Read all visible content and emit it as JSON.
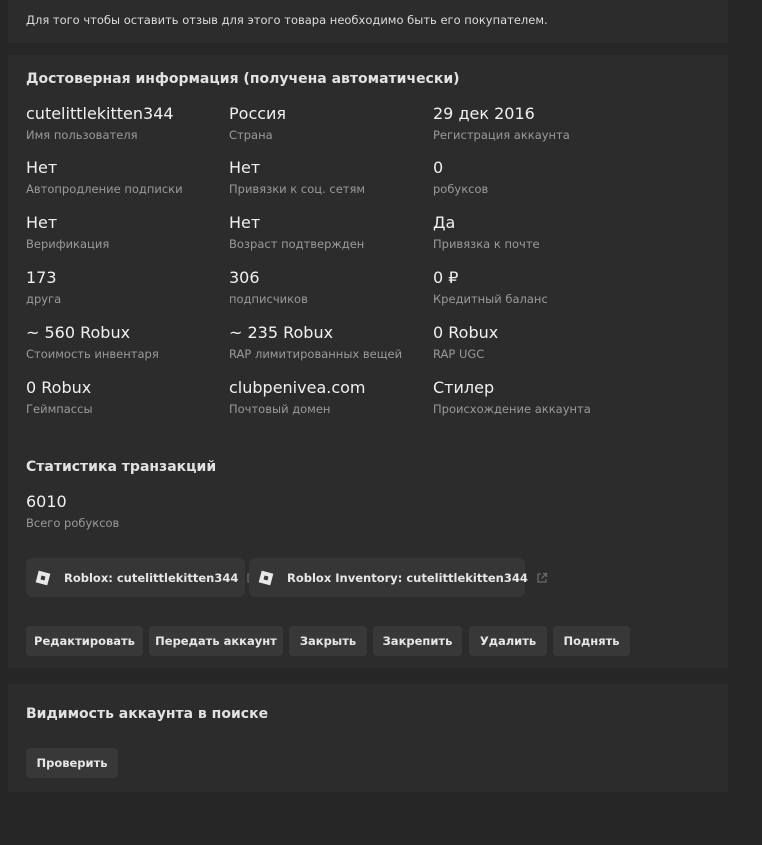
{
  "notice": {
    "text": "Для того чтобы оставить отзыв для этого товара необходимо быть его покупателем."
  },
  "info": {
    "title": "Достоверная информация (получена автоматически)",
    "grid": [
      [
        {
          "value": "cutelittlekitten344",
          "label": "Имя пользователя"
        },
        {
          "value": "Россия",
          "label": "Страна"
        },
        {
          "value": "29 дек 2016",
          "label": "Регистрация аккаунта"
        }
      ],
      [
        {
          "value": "Нет",
          "label": "Автопродление подписки"
        },
        {
          "value": "Нет",
          "label": "Привязки к соц. сетям"
        },
        {
          "value": "0",
          "label": "робуксов"
        }
      ],
      [
        {
          "value": "Нет",
          "label": "Верификация"
        },
        {
          "value": "Нет",
          "label": "Возраст подтвержден"
        },
        {
          "value": "Да",
          "label": "Привязка к почте"
        }
      ],
      [
        {
          "value": "173",
          "label": "друга"
        },
        {
          "value": "306",
          "label": "подписчиков"
        },
        {
          "value": "0 ₽",
          "label": "Кредитный баланс"
        }
      ],
      [
        {
          "value": "~ 560 Robux",
          "label": "Стоимость инвентаря"
        },
        {
          "value": "~ 235 Robux",
          "label": "RAP лимитированных вещей"
        },
        {
          "value": "0 Robux",
          "label": "RAP UGC"
        }
      ],
      [
        {
          "value": "0 Robux",
          "label": "Геймпассы"
        },
        {
          "value": "clubpenivea.com",
          "label": "Почтовый домен"
        },
        {
          "value": "Стилер",
          "label": "Происхождение аккаунта"
        }
      ]
    ]
  },
  "transactions": {
    "title": "Статистика транзакций",
    "value": "6010",
    "label": "Всего робуксов"
  },
  "links": [
    {
      "label": "Roblox: cutelittlekitten344",
      "icon": "roblox-icon"
    },
    {
      "label": "Roblox Inventory: cutelittlekitten344",
      "icon": "roblox-icon"
    }
  ],
  "actions": [
    "Редактировать",
    "Передать аккаунт",
    "Закрыть",
    "Закрепить",
    "Удалить",
    "Поднять"
  ],
  "visibility": {
    "title": "Видимость аккаунта в поиске",
    "button": "Проверить"
  }
}
